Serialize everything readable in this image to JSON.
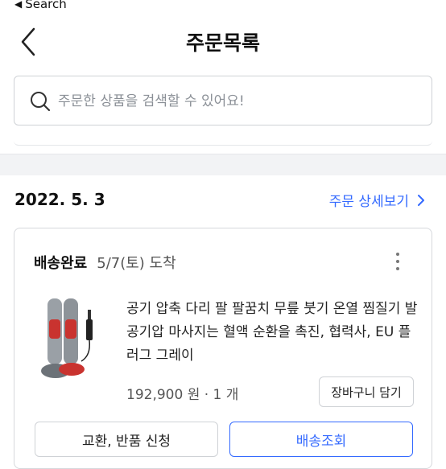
{
  "status_bar": {
    "back_app": "Search"
  },
  "header": {
    "title": "주문목록"
  },
  "search": {
    "placeholder": "주문한 상품을 검색할 수 있어요!"
  },
  "order": {
    "date": "2022. 5. 3",
    "detail_link": "주문 상세보기",
    "delivery_status": "배송완료",
    "arrival": "5/7(토) 도착",
    "product_name": "공기 압축 다리 팔 팔꿈치 무릎 붓기 온열 찜질기 발 공기압 마사지는 혈액 순환을 촉진, 협력사, EU 플러그 그레이",
    "price_qty": "192,900 원 · 1 개",
    "cart_button": "장바구니 담기",
    "exchange_button": "교환, 반품 신청",
    "track_button": "배송조회"
  },
  "colors": {
    "accent": "#346aff",
    "divider": "#f2f3f5"
  }
}
